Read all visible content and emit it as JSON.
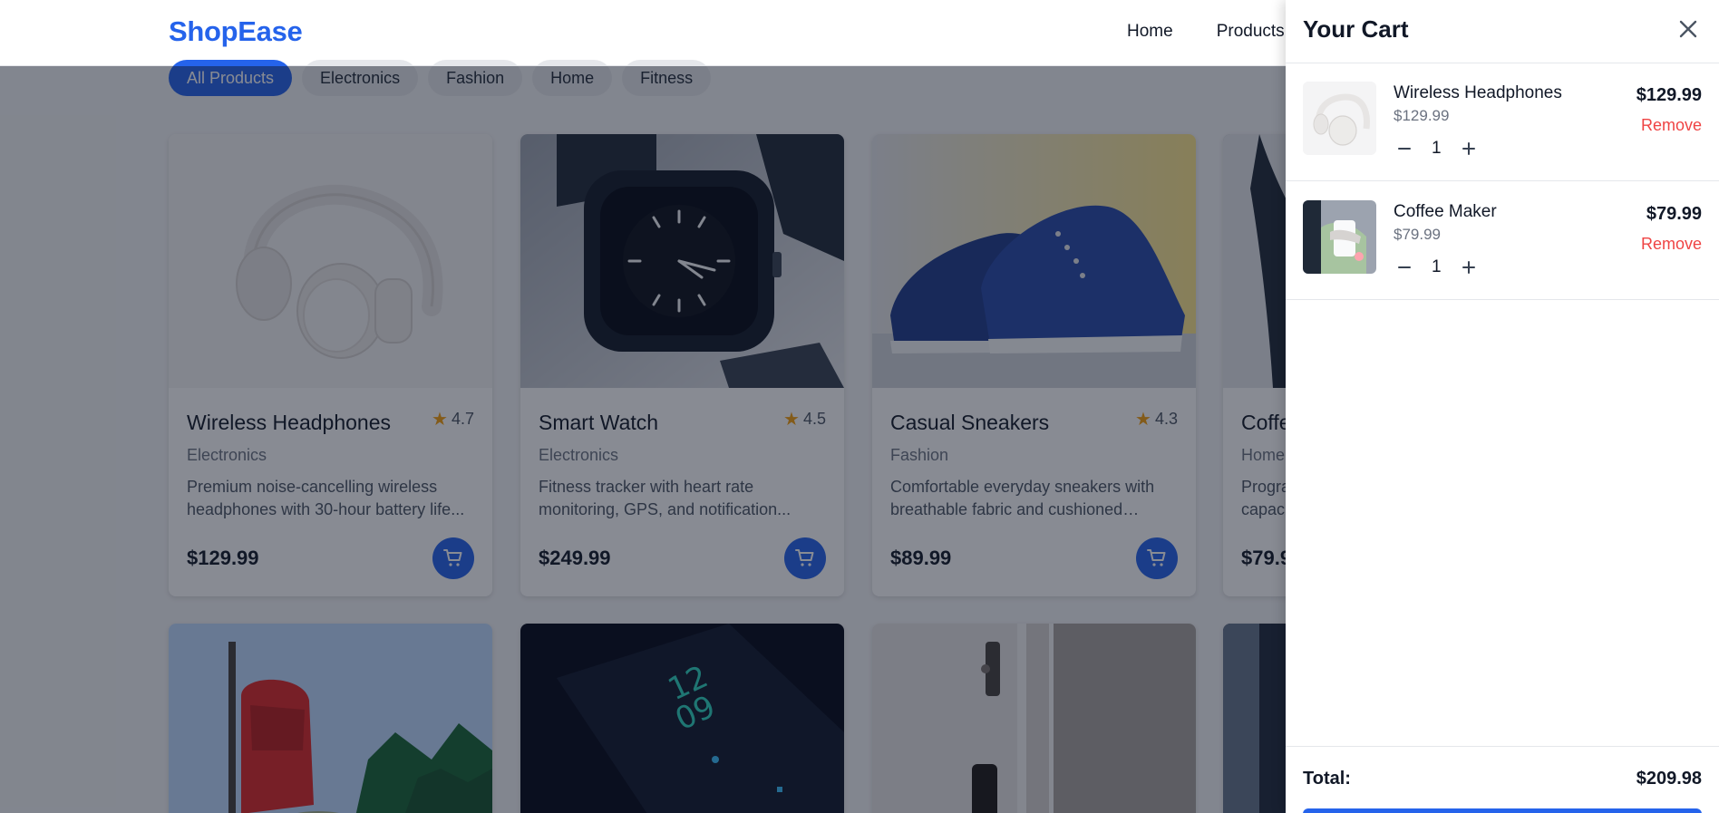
{
  "header": {
    "logo": "ShopEase",
    "nav": [
      "Home",
      "Products"
    ]
  },
  "categories": [
    "All Products",
    "Electronics",
    "Fashion",
    "Home",
    "Fitness"
  ],
  "active_category": "All Products",
  "products": [
    {
      "name": "Wireless Headphones",
      "rating": "4.7",
      "category": "Electronics",
      "description": "Premium noise-cancelling wireless headphones with 30-hour battery life...",
      "price": "$129.99",
      "image": "headphones-image"
    },
    {
      "name": "Smart Watch",
      "rating": "4.5",
      "category": "Electronics",
      "description": "Fitness tracker with heart rate monitoring, GPS, and notification...",
      "price": "$249.99",
      "image": "smartwatch-image"
    },
    {
      "name": "Casual Sneakers",
      "rating": "4.3",
      "category": "Fashion",
      "description": "Comfortable everyday sneakers with breathable fabric and cushioned insoles.",
      "price": "$89.99",
      "image": "sneakers-image"
    },
    {
      "name": "Coffe",
      "rating": "",
      "category": "Home",
      "description": "Progra capaci",
      "price": "$79.9",
      "image": "coffee-maker-image"
    }
  ],
  "products_row2_images": [
    "backpack-image",
    "phone-image",
    "door-image",
    "dark-image"
  ],
  "cart": {
    "title": "Your Cart",
    "items": [
      {
        "name": "Wireless Headphones",
        "unit_price": "$129.99",
        "quantity": "1",
        "line_total": "$129.99",
        "remove_label": "Remove",
        "image": "headphones-thumb"
      },
      {
        "name": "Coffee Maker",
        "unit_price": "$79.99",
        "quantity": "1",
        "line_total": "$79.99",
        "remove_label": "Remove",
        "image": "coffee-maker-thumb"
      }
    ],
    "total_label": "Total:",
    "total_value": "$209.98"
  },
  "colors": {
    "brand": "#2563eb",
    "danger": "#ef4444",
    "star": "#f59e0b",
    "overlay": "rgba(17,24,39,0.5)"
  }
}
